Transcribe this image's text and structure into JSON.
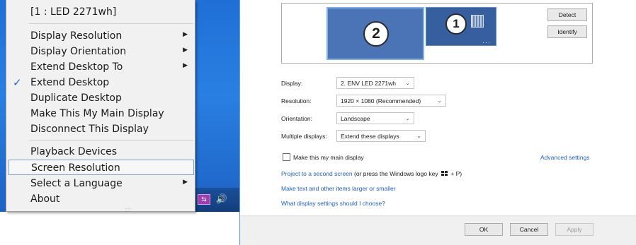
{
  "context_menu": {
    "items": [
      {
        "label": "[1 : LED 2271wh]"
      },
      {
        "label": "Display Resolution",
        "submenu": true
      },
      {
        "label": "Display Orientation",
        "submenu": true
      },
      {
        "label": "Extend Desktop To",
        "submenu": true
      },
      {
        "label": "Extend Desktop",
        "checked": true
      },
      {
        "label": "Duplicate Desktop"
      },
      {
        "label": "Make This My Main Display"
      },
      {
        "label": "Disconnect This Display"
      },
      {
        "label": "Playback Devices"
      },
      {
        "label": "Screen Resolution",
        "highlighted": true
      },
      {
        "label": "Select a Language",
        "submenu": true
      },
      {
        "label": "About"
      }
    ],
    "check_glyph": "✓",
    "submenu_glyph": "▶"
  },
  "tray": {
    "icons": [
      "usb-display-icon",
      "speaker-icon"
    ],
    "usb_glyph": "⇆",
    "speaker_glyph": "🔊"
  },
  "dialog": {
    "monitors": [
      {
        "number": "2",
        "selected": true
      },
      {
        "number": "1",
        "selected": false
      }
    ],
    "detect_label": "Detect",
    "identify_label": "Identify",
    "display_label": "Display:",
    "display_value": "2. ENV LED 2271wh",
    "resolution_label": "Resolution:",
    "resolution_value": "1920 × 1080 (Recommended)",
    "orientation_label": "Orientation:",
    "orientation_value": "Landscape",
    "multiple_label": "Multiple displays:",
    "multiple_value": "Extend these displays",
    "main_display_label": "Make this my main display",
    "main_display_checked": false,
    "advanced_link": "Advanced settings",
    "project_link": "Project to a second screen",
    "project_suffix_a": " (or press the Windows logo key ",
    "project_suffix_b": " + P)",
    "larger_link": "Make text and other items larger or smaller",
    "which_link": "What display settings should I choose?",
    "ok_label": "OK",
    "cancel_label": "Cancel",
    "apply_label": "Apply",
    "apply_enabled": false,
    "chevron_glyph": "⌄"
  },
  "colors": {
    "link": "#1f5fb8",
    "monitor_selected": "#4a74b5",
    "check": "#2b63c9",
    "usb_icon": "#a23ab3"
  }
}
